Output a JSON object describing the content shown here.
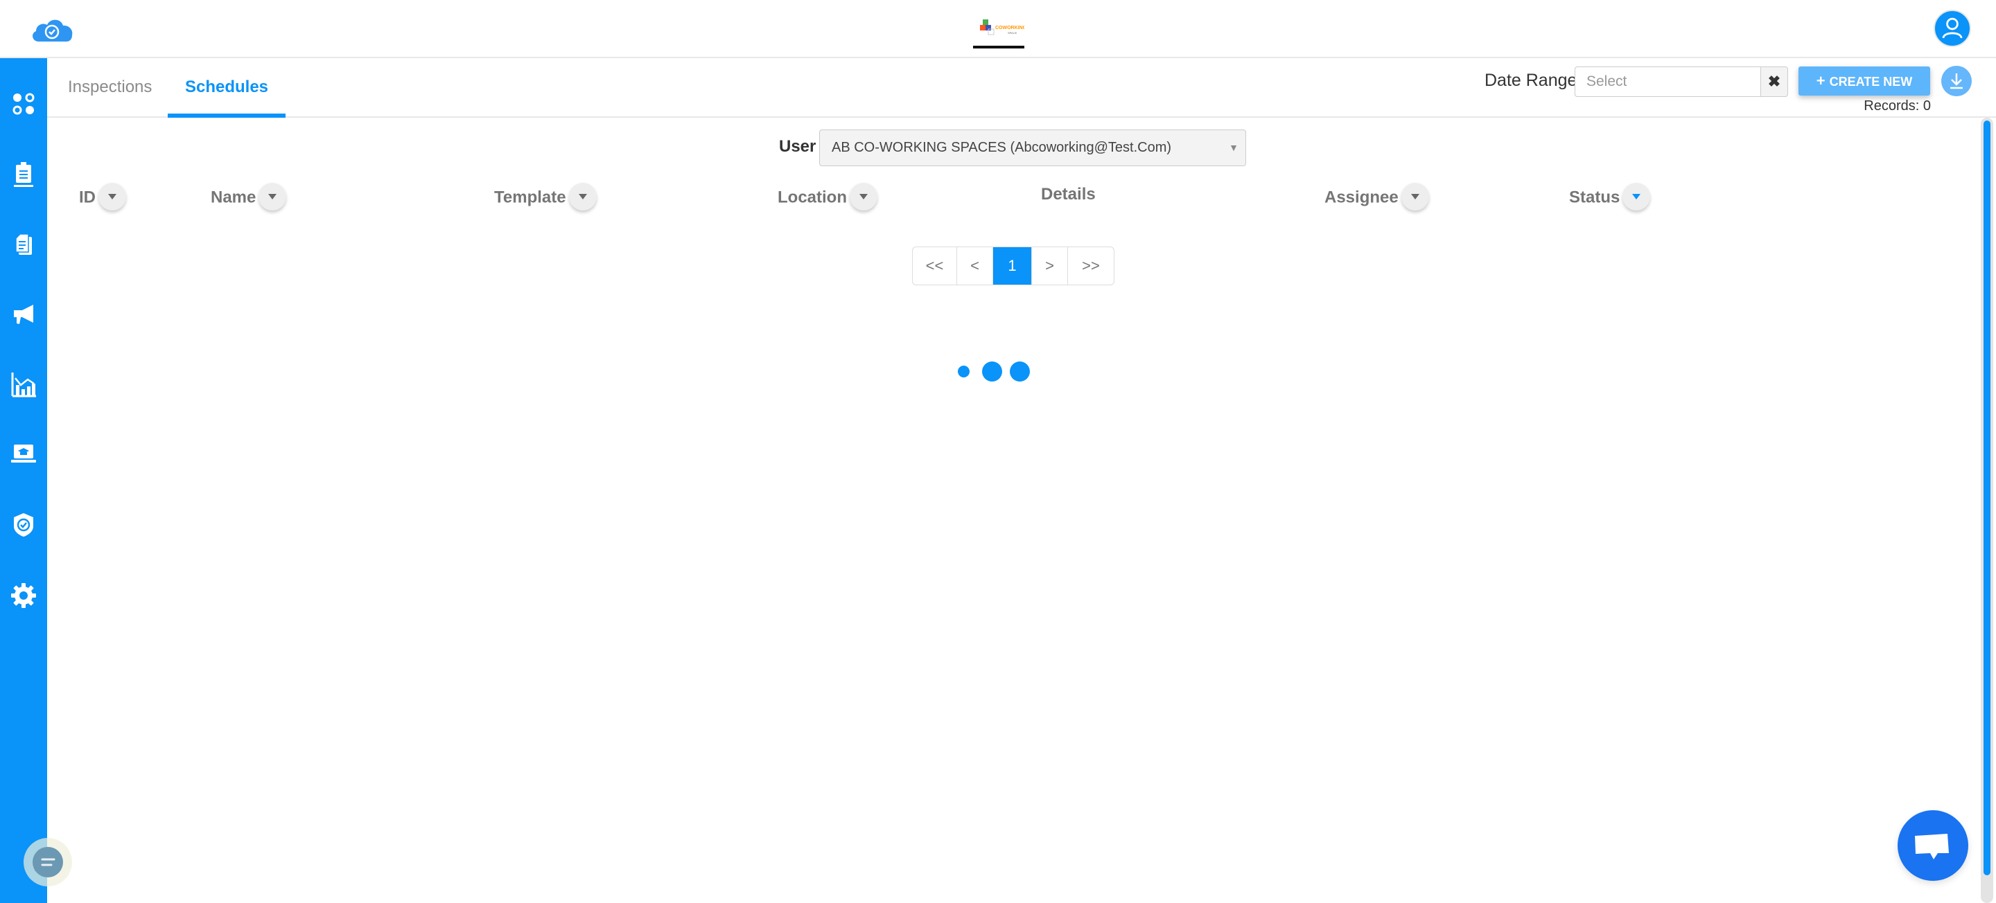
{
  "header": {
    "app_logo": "cloud-check-logo",
    "center_logo_alt": "Co-Working Space logo",
    "avatar": "user-profile-icon"
  },
  "sidebar": {
    "items": [
      {
        "name": "dashboard",
        "icon": "dots-grid-icon"
      },
      {
        "name": "inspections",
        "icon": "clipboard-icon"
      },
      {
        "name": "documents",
        "icon": "documents-icon"
      },
      {
        "name": "announcements",
        "icon": "megaphone-icon"
      },
      {
        "name": "analytics",
        "icon": "chart-icon"
      },
      {
        "name": "training",
        "icon": "laptop-graduation-icon"
      },
      {
        "name": "compliance",
        "icon": "shield-check-icon"
      },
      {
        "name": "settings",
        "icon": "gear-icon"
      }
    ]
  },
  "tabs": [
    {
      "label": "Inspections",
      "active": false
    },
    {
      "label": "Schedules",
      "active": true
    }
  ],
  "toolbar": {
    "date_range_label": "Date Range",
    "date_range_placeholder": "Select",
    "date_range_value": "",
    "clear_label": "✖",
    "create_label": "CREATE NEW",
    "create_icon": "+",
    "records_text": "Records: 0"
  },
  "filter": {
    "user_label": "User",
    "user_selected": "AB CO-WORKING SPACES (Abcoworking@Test.Com)",
    "caret": "▼"
  },
  "table": {
    "columns": [
      {
        "label": "ID",
        "sortable": true
      },
      {
        "label": "Name",
        "sortable": true
      },
      {
        "label": "Template",
        "sortable": true
      },
      {
        "label": "Location",
        "sortable": true
      },
      {
        "label": "Details",
        "sortable": false
      },
      {
        "label": "Assignee",
        "sortable": true
      },
      {
        "label": "Status",
        "sortable": true,
        "active_filter": true
      }
    ],
    "rows": []
  },
  "pagination": {
    "first": "<<",
    "prev": "<",
    "current": "1",
    "next": ">",
    "last": ">>"
  },
  "loading": true,
  "colors": {
    "primary": "#0a93f8",
    "create_button": "#5db5fb",
    "chat_button": "#1a73f0"
  }
}
